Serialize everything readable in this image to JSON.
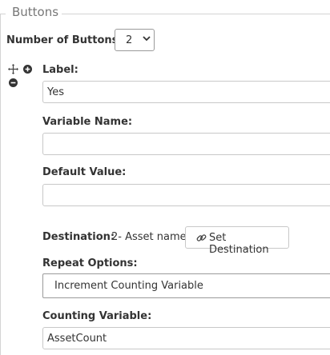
{
  "section": {
    "legend": "Buttons"
  },
  "number_of_buttons": {
    "label": "Number of Buttons",
    "selected": "2"
  },
  "icons": {
    "move": "move-icon",
    "add": "plus-circle-icon",
    "remove": "minus-circle-icon",
    "chevron": "chevron-down-icon",
    "link": "link-icon"
  },
  "button": {
    "label_label": "Label:",
    "label_value": "Yes",
    "variable_name_label": "Variable Name:",
    "variable_name_value": "",
    "default_value_label": "Default Value:",
    "default_value_value": "",
    "destination_label": "Destination:",
    "destination_value": "2- Asset name",
    "set_destination_label": "Set Destination",
    "repeat_options_label": "Repeat Options:",
    "repeat_options_selected": "Increment Counting Variable",
    "counting_variable_label": "Counting Variable:",
    "counting_variable_value": "AssetCount"
  }
}
